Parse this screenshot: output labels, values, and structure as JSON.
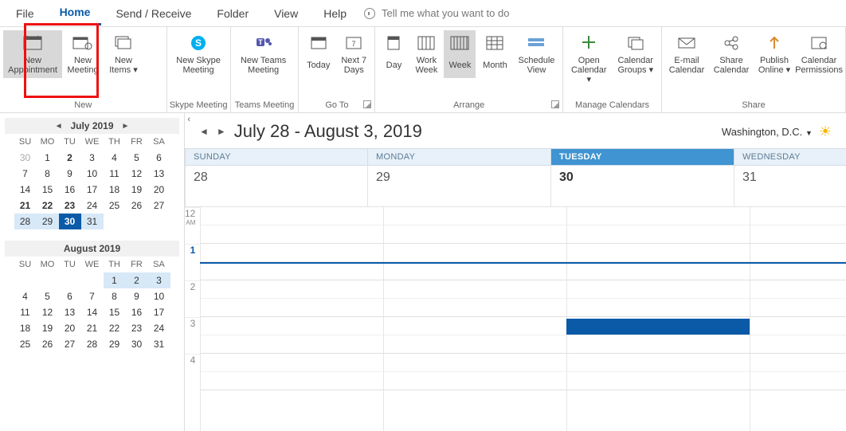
{
  "tabs": {
    "file": "File",
    "home": "Home",
    "send_receive": "Send / Receive",
    "folder": "Folder",
    "view": "View",
    "help": "Help",
    "tell_me": "Tell me what you want to do"
  },
  "ribbon": {
    "groups": {
      "new": {
        "label": "New",
        "new_appointment": "New Appointment",
        "new_meeting": "New Meeting",
        "new_items": "New Items ▾"
      },
      "skype": {
        "label": "Skype Meeting",
        "btn": "New Skype Meeting"
      },
      "teams": {
        "label": "Teams Meeting",
        "btn": "New Teams Meeting"
      },
      "goto": {
        "label": "Go To",
        "today": "Today",
        "next7": "Next 7 Days"
      },
      "arrange": {
        "label": "Arrange",
        "day": "Day",
        "work_week": "Work Week",
        "week": "Week",
        "month": "Month",
        "schedule_view": "Schedule View"
      },
      "manage": {
        "label": "Manage Calendars",
        "open_calendar": "Open Calendar ▾",
        "calendar_groups": "Calendar Groups ▾"
      },
      "share": {
        "label": "Share",
        "email": "E-mail Calendar",
        "share_cal": "Share Calendar",
        "publish": "Publish Online ▾",
        "perms": "Calendar Permissions"
      }
    }
  },
  "sidebar": {
    "minical1": {
      "title": "July 2019",
      "dow": [
        "SU",
        "MO",
        "TU",
        "WE",
        "TH",
        "FR",
        "SA"
      ],
      "cells": [
        {
          "v": "30",
          "cls": "prev"
        },
        {
          "v": "1"
        },
        {
          "v": "2",
          "cls": "bold"
        },
        {
          "v": "3"
        },
        {
          "v": "4"
        },
        {
          "v": "5"
        },
        {
          "v": "6"
        },
        {
          "v": "7"
        },
        {
          "v": "8"
        },
        {
          "v": "9"
        },
        {
          "v": "10"
        },
        {
          "v": "11"
        },
        {
          "v": "12"
        },
        {
          "v": "13"
        },
        {
          "v": "14"
        },
        {
          "v": "15"
        },
        {
          "v": "16"
        },
        {
          "v": "17"
        },
        {
          "v": "18"
        },
        {
          "v": "19"
        },
        {
          "v": "20"
        },
        {
          "v": "21",
          "cls": "bold"
        },
        {
          "v": "22",
          "cls": "bold"
        },
        {
          "v": "23",
          "cls": "bold"
        },
        {
          "v": "24"
        },
        {
          "v": "25"
        },
        {
          "v": "26"
        },
        {
          "v": "27"
        },
        {
          "v": "28",
          "cls": "range"
        },
        {
          "v": "29",
          "cls": "range"
        },
        {
          "v": "30",
          "cls": "today"
        },
        {
          "v": "31",
          "cls": "range"
        },
        {
          "v": "",
          "cls": "next"
        },
        {
          "v": "",
          "cls": "next"
        },
        {
          "v": "",
          "cls": "next"
        }
      ]
    },
    "minical2": {
      "title": "August 2019",
      "dow": [
        "SU",
        "MO",
        "TU",
        "WE",
        "TH",
        "FR",
        "SA"
      ],
      "cells": [
        {
          "v": ""
        },
        {
          "v": ""
        },
        {
          "v": ""
        },
        {
          "v": ""
        },
        {
          "v": "1",
          "cls": "range"
        },
        {
          "v": "2",
          "cls": "range"
        },
        {
          "v": "3",
          "cls": "range"
        },
        {
          "v": "4"
        },
        {
          "v": "5"
        },
        {
          "v": "6"
        },
        {
          "v": "7"
        },
        {
          "v": "8"
        },
        {
          "v": "9"
        },
        {
          "v": "10"
        },
        {
          "v": "11"
        },
        {
          "v": "12"
        },
        {
          "v": "13"
        },
        {
          "v": "14"
        },
        {
          "v": "15"
        },
        {
          "v": "16"
        },
        {
          "v": "17"
        },
        {
          "v": "18"
        },
        {
          "v": "19"
        },
        {
          "v": "20"
        },
        {
          "v": "21"
        },
        {
          "v": "22"
        },
        {
          "v": "23"
        },
        {
          "v": "24"
        },
        {
          "v": "25"
        },
        {
          "v": "26"
        },
        {
          "v": "27"
        },
        {
          "v": "28"
        },
        {
          "v": "29"
        },
        {
          "v": "30"
        },
        {
          "v": "31"
        }
      ]
    }
  },
  "main": {
    "range_text": "July 28 - August 3, 2019",
    "location": "Washington, D.C.",
    "days": [
      {
        "name": "SUNDAY",
        "num": "28",
        "tue": false,
        "bold": false
      },
      {
        "name": "MONDAY",
        "num": "29",
        "tue": false,
        "bold": false
      },
      {
        "name": "TUESDAY",
        "num": "30",
        "tue": true,
        "bold": true
      },
      {
        "name": "WEDNESDAY",
        "num": "31",
        "tue": false,
        "bold": false
      }
    ],
    "hours": [
      "12 AM",
      "1",
      "2",
      "3",
      "4"
    ]
  }
}
